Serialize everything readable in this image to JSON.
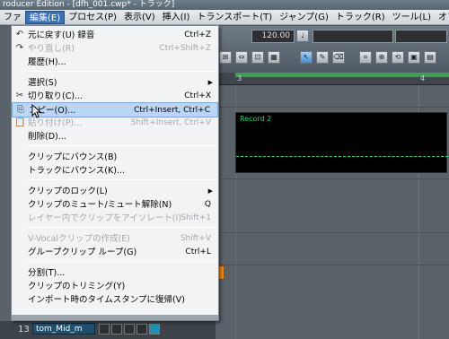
{
  "window": {
    "title": "roducer Edition - [dfh_001.cwp* - トラック]"
  },
  "menubar": {
    "items": [
      {
        "label": "ファ",
        "name": "menu-file"
      },
      {
        "label": "編集(E)",
        "name": "menu-edit",
        "open": true
      },
      {
        "label": "プロセス(P)",
        "name": "menu-process"
      },
      {
        "label": "表示(V)",
        "name": "menu-view"
      },
      {
        "label": "挿入(I)",
        "name": "menu-insert"
      },
      {
        "label": "トランスポート(T)",
        "name": "menu-transport"
      },
      {
        "label": "ジャンプ(G)",
        "name": "menu-jump"
      },
      {
        "label": "トラック(R)",
        "name": "menu-track"
      },
      {
        "label": "ツール(L)",
        "name": "menu-tools"
      },
      {
        "label": "オプション(",
        "name": "menu-options"
      }
    ]
  },
  "toolbar": {
    "tempo": "120.00"
  },
  "ruler": {
    "ticks": [
      "3",
      "4"
    ]
  },
  "clip": {
    "name": "Record 2"
  },
  "bottom": {
    "track_number": "13",
    "track_name": "tom_Mid_m"
  },
  "edit_menu": {
    "items": [
      {
        "label": "元に戻す(U) 録音",
        "shortcut": "Ctrl+Z",
        "icon": "undo-icon",
        "glyph": "↶",
        "disabled": false
      },
      {
        "label": "やり直し(R)",
        "shortcut": "Ctrl+Shift+Z",
        "icon": "redo-icon",
        "glyph": "↷",
        "disabled": true
      },
      {
        "label": "履歴(H)...",
        "shortcut": "",
        "icon": "",
        "glyph": "",
        "disabled": false
      },
      {
        "sep": true
      },
      {
        "label": "選択(S)",
        "shortcut": "",
        "icon": "",
        "glyph": "",
        "disabled": false,
        "submenu": true
      },
      {
        "label": "切り取り(C)...",
        "shortcut": "Ctrl+X",
        "icon": "scissors-icon",
        "glyph": "✂",
        "disabled": false
      },
      {
        "label": "コピー(O)...",
        "shortcut": "Ctrl+Insert, Ctrl+C",
        "icon": "copy-icon",
        "glyph": "⎘",
        "disabled": false,
        "highlight": true
      },
      {
        "label": "貼り付け(P)...",
        "shortcut": "Shift+Insert, Ctrl+V",
        "icon": "paste-icon",
        "glyph": "📋",
        "disabled": true
      },
      {
        "label": "削除(D)...",
        "shortcut": "",
        "icon": "",
        "glyph": "",
        "disabled": false
      },
      {
        "sep": true
      },
      {
        "label": "クリップにバウンス(B)",
        "shortcut": "",
        "icon": "",
        "glyph": "",
        "disabled": false
      },
      {
        "label": "トラックにバウンス(K)...",
        "shortcut": "",
        "icon": "",
        "glyph": "",
        "disabled": false
      },
      {
        "sep": true
      },
      {
        "label": "クリップのロック(L)",
        "shortcut": "",
        "icon": "",
        "glyph": "",
        "disabled": false,
        "submenu": true
      },
      {
        "label": "クリップのミュート/ミュート解除(N)",
        "shortcut": "Q",
        "icon": "",
        "glyph": "",
        "disabled": false
      },
      {
        "label": "レイヤー内でクリップをアイソレート(I)",
        "shortcut": "Shift+1",
        "icon": "",
        "glyph": "",
        "disabled": true
      },
      {
        "sep": true
      },
      {
        "label": "V-Vocalクリップの作成(E)",
        "shortcut": "Shift+V",
        "icon": "",
        "glyph": "",
        "disabled": true
      },
      {
        "label": "グループクリップ ループ(G)",
        "shortcut": "Ctrl+L",
        "icon": "",
        "glyph": "",
        "disabled": false
      },
      {
        "sep": true
      },
      {
        "label": "分割(T)...",
        "shortcut": "",
        "icon": "",
        "glyph": "",
        "disabled": false
      },
      {
        "label": "クリップのトリミング(Y)",
        "shortcut": "",
        "icon": "",
        "glyph": "",
        "disabled": false
      },
      {
        "label": "インポート時のタイムスタンプに復帰(V)",
        "shortcut": "",
        "icon": "",
        "glyph": "",
        "disabled": false
      }
    ]
  },
  "colors": {
    "accent": "#3d6fb5",
    "highlight": "#b9d7f5",
    "clip_wave": "#2fd36a",
    "orange": "#f08a1c"
  }
}
